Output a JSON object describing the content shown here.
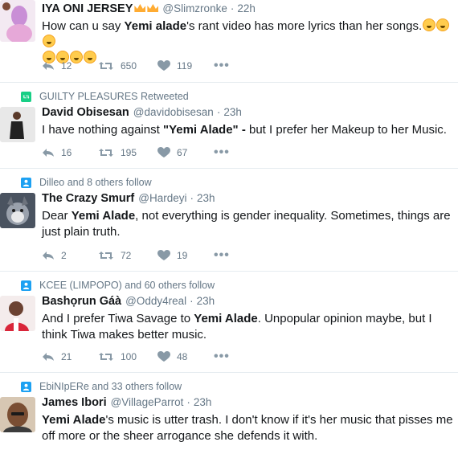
{
  "tweets": [
    {
      "context": "",
      "name": "IYA ONI JERSEY",
      "handle": "@Slimzronke",
      "time": "22h",
      "text_parts": [
        "How can u say ",
        "Yemi alade",
        "'s rant video has more lyrics than her songs."
      ],
      "replies": "12",
      "retweets": "650",
      "likes": "119"
    },
    {
      "context": "GUILTY PLEASURES Retweeted",
      "name": "David Obisesan",
      "handle": "@davidobisesan",
      "time": "23h",
      "text_parts": [
        "I have nothing against ",
        "\"Yemi Alade\" -",
        " but I prefer her Makeup to her Music."
      ],
      "replies": "16",
      "retweets": "195",
      "likes": "67"
    },
    {
      "context": "Dilleo and 8 others follow",
      "name": "The Crazy Smurf",
      "handle": "@Hardeyi",
      "time": "23h",
      "text_parts": [
        "Dear ",
        "Yemi Alade",
        ", not everything is gender inequality. Sometimes, things are just plain truth."
      ],
      "replies": "2",
      "retweets": "72",
      "likes": "19"
    },
    {
      "context": "KCEE (LIMPOPO) and 60 others follow",
      "name": "Bashọrun Gáà",
      "handle": "@Oddy4real",
      "time": "23h",
      "text_parts": [
        "And I prefer Tiwa Savage to ",
        "Yemi Alade",
        ".  Unpopular opinion maybe, but I think Tiwa makes better music."
      ],
      "replies": "21",
      "retweets": "100",
      "likes": "48"
    },
    {
      "context": "EbiNIpERe and 33 others follow",
      "name": "James Ibori",
      "handle": "@VillageParrot",
      "time": "23h",
      "text_parts": [
        "",
        "Yemi Alade",
        "'s music is utter trash. I don't know if it's her music that pisses me off more or the sheer arrogance she defends it with."
      ],
      "replies": "",
      "retweets": "",
      "likes": ""
    }
  ],
  "ui": {
    "dot": "·",
    "more": "•••"
  },
  "colors": {
    "link": "#1da1f2",
    "secondary": "#657786",
    "retweet": "#19cf86",
    "divider": "#e6ecf0"
  },
  "icons": [
    "reply-icon",
    "retweet-icon",
    "heart-icon",
    "more-icon",
    "retweet-context-icon",
    "follow-context-icon",
    "crown-emoji-icon",
    "laughing-emoji-icon",
    "crying-emoji-icon"
  ]
}
